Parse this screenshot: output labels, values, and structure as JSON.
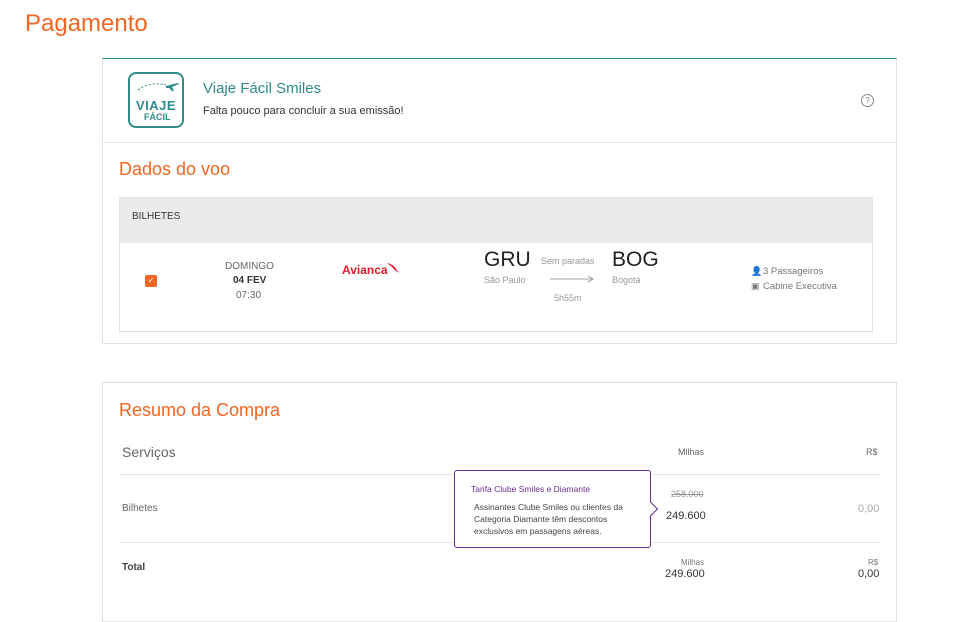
{
  "page": {
    "title": "Pagamento"
  },
  "viaje_facil": {
    "logo_line1": "VIAJE",
    "logo_line2": "FÁCIL",
    "title": "Viaje Fácil Smiles",
    "subtitle": "Falta pouco para concluir a sua emissão!",
    "help_icon": "question-circle-icon"
  },
  "dados_voo": {
    "title": "Dados do voo",
    "tickets_header": "BILHETES",
    "flight": {
      "selected": true,
      "day": "DOMINGO",
      "date": "04 FEV",
      "time": "07:30",
      "airline": "Avianca",
      "origin_code": "GRU",
      "origin_city": "São Paulo",
      "stops": "Sem paradas",
      "duration": "5h55m",
      "destination_code": "BOG",
      "destination_city": "Bogotá",
      "passengers": "3 Passageiros",
      "cabin": "Cabine Executiva"
    }
  },
  "resumo": {
    "title": "Resumo da Compra",
    "col_service": "Serviços",
    "col_miles": "Milhas",
    "col_money": "R$",
    "rows": [
      {
        "label": "Bilhetes",
        "old_miles": "258.000",
        "miles": "249.600",
        "money": "0,00"
      }
    ],
    "total": {
      "label": "Total",
      "miles_label": "Milhas",
      "miles": "249.600",
      "money_label": "R$",
      "money": "0,00"
    }
  },
  "tooltip": {
    "title": "Tarifa Clube Smiles e Diamante",
    "body": "Assinantes Clube Smiles ou clientes da Categoria Diamante têm descontos exclusivos em passagens aéreas."
  },
  "colors": {
    "accent": "#f26522",
    "teal": "#2e8b8b",
    "purple": "#6b2c91",
    "airline_red": "#d81e2a"
  }
}
